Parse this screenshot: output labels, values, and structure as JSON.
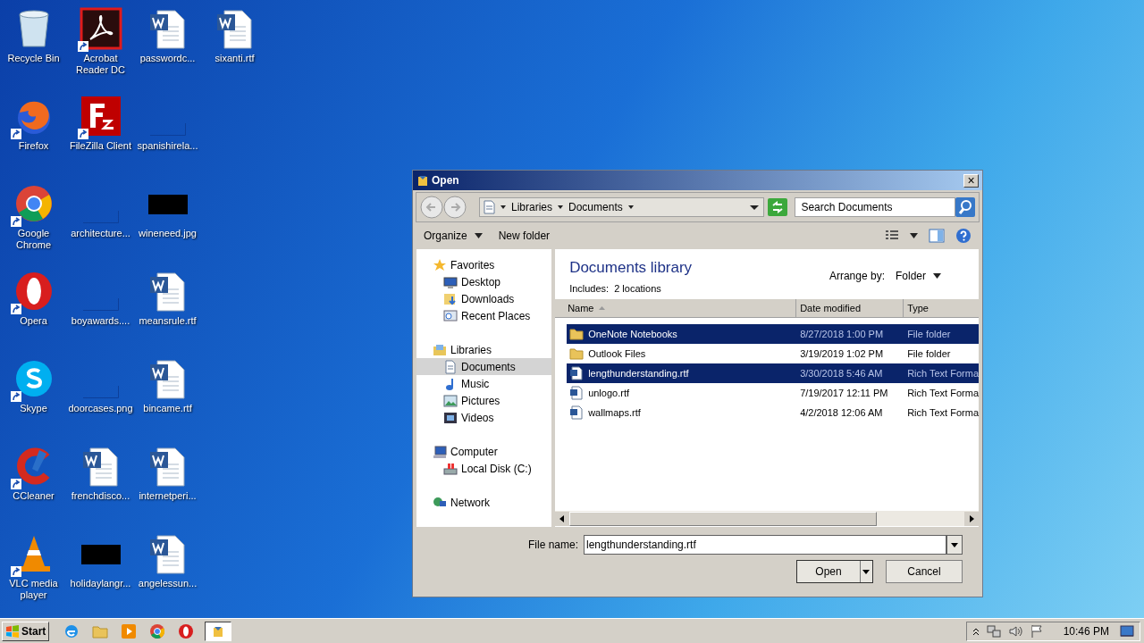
{
  "desktop_icons": [
    {
      "label": "Recycle Bin",
      "kind": "recycle",
      "shortcut": false
    },
    {
      "label": "Firefox",
      "kind": "firefox",
      "shortcut": true
    },
    {
      "label": "Google Chrome",
      "kind": "chrome",
      "shortcut": true
    },
    {
      "label": "Opera",
      "kind": "opera",
      "shortcut": true
    },
    {
      "label": "Skype",
      "kind": "skype",
      "shortcut": true
    },
    {
      "label": "CCleaner",
      "kind": "ccleaner",
      "shortcut": true
    },
    {
      "label": "VLC media player",
      "kind": "vlc",
      "shortcut": true
    },
    {
      "label": "Acrobat Reader DC",
      "kind": "acrobat",
      "shortcut": true
    },
    {
      "label": "FileZilla Client",
      "kind": "filezilla",
      "shortcut": true
    },
    {
      "label": "architecture...",
      "kind": "blank",
      "shortcut": false
    },
    {
      "label": "boyawards....",
      "kind": "blank",
      "shortcut": false
    },
    {
      "label": "doorcases.png",
      "kind": "blank",
      "shortcut": false
    },
    {
      "label": "frenchdisco...",
      "kind": "word",
      "shortcut": false
    },
    {
      "label": "holidaylangr...",
      "kind": "dark",
      "shortcut": false
    },
    {
      "label": "passwordc...",
      "kind": "word",
      "shortcut": false
    },
    {
      "label": "spanishirela...",
      "kind": "blank",
      "shortcut": false
    },
    {
      "label": "wineneed.jpg",
      "kind": "dark",
      "shortcut": false
    },
    {
      "label": "meansrule.rtf",
      "kind": "word",
      "shortcut": false
    },
    {
      "label": "bincame.rtf",
      "kind": "word",
      "shortcut": false
    },
    {
      "label": "internetperi...",
      "kind": "word",
      "shortcut": false
    },
    {
      "label": "angelessun...",
      "kind": "word",
      "shortcut": false
    },
    {
      "label": "sixanti.rtf",
      "kind": "word",
      "shortcut": false
    }
  ],
  "dialog": {
    "title": "Open",
    "close": "×",
    "breadcrumb": [
      "Libraries",
      "Documents"
    ],
    "search": {
      "placeholder": "Search Documents"
    },
    "toolbar": {
      "organize": "Organize",
      "new_folder": "New folder"
    },
    "nav": [
      {
        "label": "Favorites",
        "selected": false,
        "children": [
          {
            "label": "Desktop",
            "selected": false
          },
          {
            "label": "Downloads",
            "selected": false
          },
          {
            "label": "Recent Places",
            "selected": false
          }
        ]
      },
      {
        "label": "Libraries",
        "selected": false,
        "children": [
          {
            "label": "Documents",
            "selected": true
          },
          {
            "label": "Music",
            "selected": false
          },
          {
            "label": "Pictures",
            "selected": false
          },
          {
            "label": "Videos",
            "selected": false
          }
        ]
      },
      {
        "label": "Computer",
        "selected": false,
        "children": [
          {
            "label": "Local Disk (C:)",
            "selected": false
          }
        ]
      },
      {
        "label": "Network",
        "selected": false
      }
    ],
    "library_title": "Documents library",
    "includes_label": "Includes:",
    "includes_value": "2 locations",
    "arrange_label": "Arrange by:",
    "arrange_value": "Folder",
    "columns": [
      {
        "label": "Name",
        "sorted": true
      },
      {
        "label": "Date modified",
        "sorted": false
      },
      {
        "label": "Type",
        "sorted": false
      }
    ],
    "files": [
      {
        "name": "OneNote Notebooks",
        "date": "8/27/2018 1:00 PM",
        "type": "File folder",
        "kind": "folder",
        "selected": true
      },
      {
        "name": "Outlook Files",
        "date": "3/19/2019 1:02 PM",
        "type": "File folder",
        "kind": "folder",
        "selected": false
      },
      {
        "name": "lengthunderstanding.rtf",
        "date": "3/30/2018 5:46 AM",
        "type": "Rich Text Forma",
        "kind": "rtf",
        "selected": true
      },
      {
        "name": "unlogo.rtf",
        "date": "7/19/2017 12:11 PM",
        "type": "Rich Text Forma",
        "kind": "rtf",
        "selected": false
      },
      {
        "name": "wallmaps.rtf",
        "date": "4/2/2018 12:06 AM",
        "type": "Rich Text Forma",
        "kind": "rtf",
        "selected": false
      }
    ],
    "file_name_label": "File name:",
    "file_name": "lengthunderstanding.rtf",
    "buttons": {
      "open": "Open",
      "cancel": "Cancel"
    }
  },
  "taskbar": {
    "start": "Start",
    "tasks": [
      {
        "kind": "dialog",
        "selected": true
      }
    ],
    "clock": "10:46 PM"
  }
}
